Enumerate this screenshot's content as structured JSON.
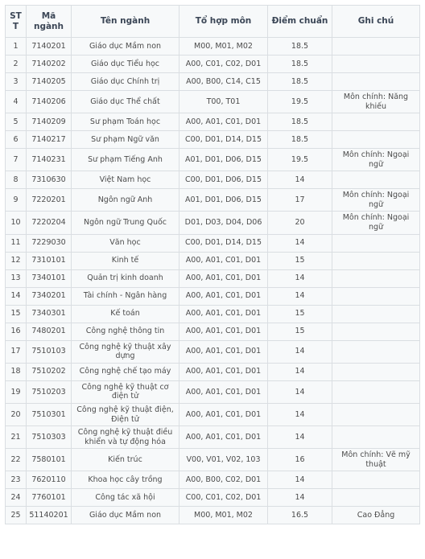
{
  "table": {
    "name": "university-admission-benchmark-scores",
    "columns": [
      {
        "key": "stt",
        "label": "STT"
      },
      {
        "key": "code",
        "label": "Mã ngành"
      },
      {
        "key": "name",
        "label": "Tên ngành"
      },
      {
        "key": "combo",
        "label": "Tổ hợp môn"
      },
      {
        "key": "score",
        "label": "Điểm chuẩn"
      },
      {
        "key": "note",
        "label": "Ghi chú"
      }
    ],
    "rows": [
      {
        "stt": "1",
        "code": "7140201",
        "name": "Giáo dục Mầm non",
        "combo": "M00, M01, M02",
        "score": "18.5",
        "note": ""
      },
      {
        "stt": "2",
        "code": "7140202",
        "name": "Giáo dục Tiểu học",
        "combo": "A00, C01, C02, D01",
        "score": "18.5",
        "note": ""
      },
      {
        "stt": "3",
        "code": "7140205",
        "name": "Giáo dục Chính trị",
        "combo": "A00, B00, C14, C15",
        "score": "18.5",
        "note": ""
      },
      {
        "stt": "4",
        "code": "7140206",
        "name": "Giáo dục Thể chất",
        "combo": "T00, T01",
        "score": "19.5",
        "note": "Môn chính: Năng khiếu"
      },
      {
        "stt": "5",
        "code": "7140209",
        "name": "Sư phạm Toán học",
        "combo": "A00, A01, C01, D01",
        "score": "18.5",
        "note": ""
      },
      {
        "stt": "6",
        "code": "7140217",
        "name": "Sư phạm Ngữ văn",
        "combo": "C00, D01, D14, D15",
        "score": "18.5",
        "note": ""
      },
      {
        "stt": "7",
        "code": "7140231",
        "name": "Sư phạm Tiếng Anh",
        "combo": "A01, D01, D06, D15",
        "score": "19.5",
        "note": "Môn chính: Ngoại ngữ"
      },
      {
        "stt": "8",
        "code": "7310630",
        "name": "Việt Nam học",
        "combo": "C00, D01, D06, D15",
        "score": "14",
        "note": ""
      },
      {
        "stt": "9",
        "code": "7220201",
        "name": "Ngôn ngữ Anh",
        "combo": "A01, D01, D06, D15",
        "score": "17",
        "note": "Môn chính: Ngoại ngữ"
      },
      {
        "stt": "10",
        "code": "7220204",
        "name": "Ngôn ngữ Trung Quốc",
        "combo": "D01, D03, D04, D06",
        "score": "20",
        "note": "Môn chính: Ngoại ngữ"
      },
      {
        "stt": "11",
        "code": "7229030",
        "name": "Văn học",
        "combo": "C00, D01, D14, D15",
        "score": "14",
        "note": ""
      },
      {
        "stt": "12",
        "code": "7310101",
        "name": "Kinh tế",
        "combo": "A00, A01, C01, D01",
        "score": "15",
        "note": ""
      },
      {
        "stt": "13",
        "code": "7340101",
        "name": "Quản trị kinh doanh",
        "combo": "A00, A01, C01, D01",
        "score": "14",
        "note": ""
      },
      {
        "stt": "14",
        "code": "7340201",
        "name": "Tài chính - Ngân hàng",
        "combo": "A00, A01, C01, D01",
        "score": "14",
        "note": ""
      },
      {
        "stt": "15",
        "code": "7340301",
        "name": "Kế toán",
        "combo": "A00, A01, C01, D01",
        "score": "15",
        "note": ""
      },
      {
        "stt": "16",
        "code": "7480201",
        "name": "Công nghệ thông tin",
        "combo": "A00, A01, C01, D01",
        "score": "15",
        "note": ""
      },
      {
        "stt": "17",
        "code": "7510103",
        "name": "Công nghệ kỹ thuật xây dựng",
        "combo": "A00, A01, C01, D01",
        "score": "14",
        "note": ""
      },
      {
        "stt": "18",
        "code": "7510202",
        "name": "Công nghệ chế tạo máy",
        "combo": "A00, A01, C01, D01",
        "score": "14",
        "note": ""
      },
      {
        "stt": "19",
        "code": "7510203",
        "name": "Công nghệ kỹ thuật cơ điện tử",
        "combo": "A00, A01, C01, D01",
        "score": "14",
        "note": ""
      },
      {
        "stt": "20",
        "code": "7510301",
        "name": "Công nghệ kỹ thuật điện, Điện tử",
        "combo": "A00, A01, C01, D01",
        "score": "14",
        "note": ""
      },
      {
        "stt": "21",
        "code": "7510303",
        "name": "Công nghệ kỹ thuật điều khiển và tự động hóa",
        "combo": "A00, A01, C01, D01",
        "score": "14",
        "note": ""
      },
      {
        "stt": "22",
        "code": "7580101",
        "name": "Kiến trúc",
        "combo": "V00, V01, V02, 103",
        "score": "16",
        "note": "Môn chính: Vẽ mỹ thuật"
      },
      {
        "stt": "23",
        "code": "7620110",
        "name": "Khoa học cây trồng",
        "combo": "A00, B00, C02, D01",
        "score": "14",
        "note": ""
      },
      {
        "stt": "24",
        "code": "7760101",
        "name": "Công tác xã hội",
        "combo": "C00, C01, C02, D01",
        "score": "14",
        "note": ""
      },
      {
        "stt": "25",
        "code": "51140201",
        "name": "Giáo dục Mầm non",
        "combo": "M00, M01, M02",
        "score": "16.5",
        "note": "Cao Đẳng"
      }
    ]
  },
  "colors": {
    "header_text": "#3b4656",
    "body_text": "#4c4c4c",
    "border": "#dadee2",
    "cell_background": "#f7f9fa"
  }
}
